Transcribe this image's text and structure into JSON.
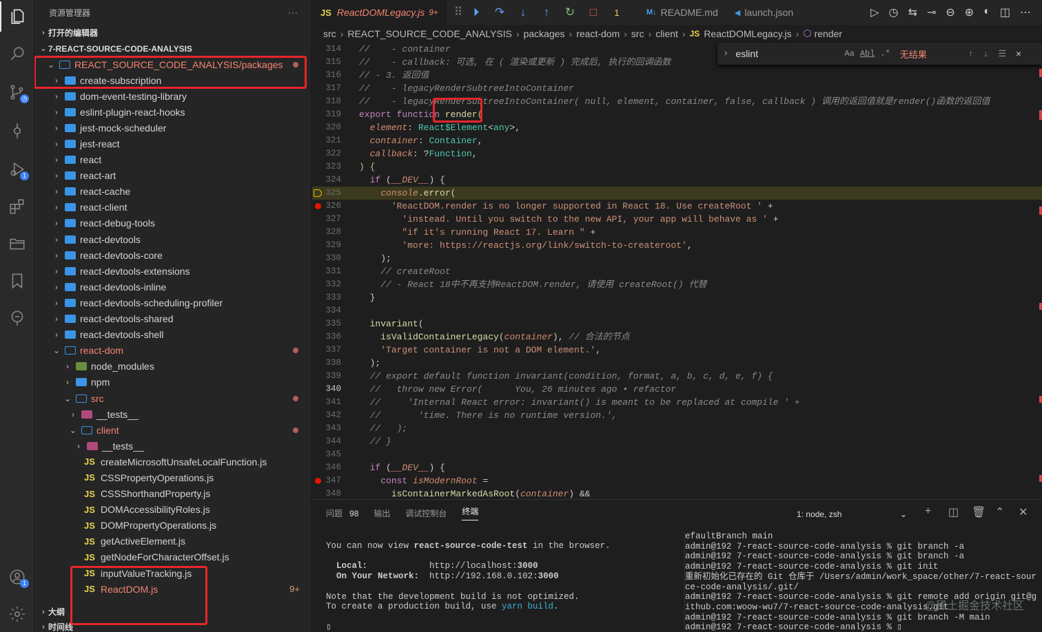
{
  "sidebar": {
    "title": "资源管理器",
    "open_editors": "打开的编辑器",
    "root": "7-REACT-SOURCE-CODE-ANALYSIS",
    "outline": "大纲",
    "timeline": "时间线",
    "items": [
      {
        "label": "REACT_SOURCE_CODE_ANALYSIS/packages",
        "kind": "folder-open",
        "depth": 1,
        "red": true,
        "dot": true
      },
      {
        "label": "create-subscription",
        "kind": "folder",
        "depth": 2
      },
      {
        "label": "dom-event-testing-library",
        "kind": "folder",
        "depth": 2
      },
      {
        "label": "eslint-plugin-react-hooks",
        "kind": "folder",
        "depth": 2
      },
      {
        "label": "jest-mock-scheduler",
        "kind": "folder",
        "depth": 2
      },
      {
        "label": "jest-react",
        "kind": "folder",
        "depth": 2
      },
      {
        "label": "react",
        "kind": "folder",
        "depth": 2
      },
      {
        "label": "react-art",
        "kind": "folder",
        "depth": 2
      },
      {
        "label": "react-cache",
        "kind": "folder",
        "depth": 2
      },
      {
        "label": "react-client",
        "kind": "folder",
        "depth": 2
      },
      {
        "label": "react-debug-tools",
        "kind": "folder",
        "depth": 2
      },
      {
        "label": "react-devtools",
        "kind": "folder",
        "depth": 2
      },
      {
        "label": "react-devtools-core",
        "kind": "folder",
        "depth": 2
      },
      {
        "label": "react-devtools-extensions",
        "kind": "folder",
        "depth": 2
      },
      {
        "label": "react-devtools-inline",
        "kind": "folder",
        "depth": 2
      },
      {
        "label": "react-devtools-scheduling-profiler",
        "kind": "folder",
        "depth": 2
      },
      {
        "label": "react-devtools-shared",
        "kind": "folder",
        "depth": 2
      },
      {
        "label": "react-devtools-shell",
        "kind": "folder",
        "depth": 2
      },
      {
        "label": "react-dom",
        "kind": "folder-open",
        "depth": 2,
        "red": true,
        "dot": true
      },
      {
        "label": "node_modules",
        "kind": "nm",
        "depth": 3
      },
      {
        "label": "npm",
        "kind": "folder",
        "depth": 3
      },
      {
        "label": "src",
        "kind": "folder-open",
        "depth": 3,
        "red": true,
        "dot": true
      },
      {
        "label": "__tests__",
        "kind": "test",
        "depth": 4
      },
      {
        "label": "client",
        "kind": "folder-open",
        "depth": 4,
        "red": true,
        "dot": true
      },
      {
        "label": "__tests__",
        "kind": "test",
        "depth": 5
      },
      {
        "label": "createMicrosoftUnsafeLocalFunction.js",
        "kind": "js",
        "depth": 5
      },
      {
        "label": "CSSPropertyOperations.js",
        "kind": "js",
        "depth": 5
      },
      {
        "label": "CSSShorthandProperty.js",
        "kind": "js",
        "depth": 5
      },
      {
        "label": "DOMAccessibilityRoles.js",
        "kind": "js",
        "depth": 5
      },
      {
        "label": "DOMPropertyOperations.js",
        "kind": "js",
        "depth": 5
      },
      {
        "label": "getActiveElement.js",
        "kind": "js",
        "depth": 5
      },
      {
        "label": "getNodeForCharacterOffset.js",
        "kind": "js",
        "depth": 5
      },
      {
        "label": "inputValueTracking.js",
        "kind": "js",
        "depth": 5
      },
      {
        "label": "ReactDOM.js",
        "kind": "js",
        "depth": 5,
        "red": true,
        "count": "9+"
      }
    ]
  },
  "tabs": [
    {
      "label": "ReactDOMLegacy.js",
      "badge": "9+",
      "icon": "JS"
    },
    {
      "label": "README.md",
      "icon": "M↓"
    },
    {
      "label": "launch.json",
      "icon": "VS"
    }
  ],
  "debug_count": "1",
  "breadcrumb": [
    "src",
    "REACT_SOURCE_CODE_ANALYSIS",
    "packages",
    "react-dom",
    "src",
    "client",
    "ReactDOMLegacy.js",
    "render"
  ],
  "find": {
    "value": "eslint",
    "result": "无结果",
    "opt_case": "Aa",
    "opt_word": "Abl",
    "opt_regex": ".*"
  },
  "code_lines": [
    {
      "n": "314",
      "html": "<span class=\"cm\">//    - container</span>"
    },
    {
      "n": "315",
      "html": "<span class=\"cm\">//    - callback: 可选, 在 ( 渲染或更新 ) 完成后, 执行的回调函数</span>"
    },
    {
      "n": "316",
      "html": "<span class=\"cm\">// - 3. 返回值</span>"
    },
    {
      "n": "317",
      "html": "<span class=\"cm\">//    - legacyRenderSubtreeIntoContainer</span>"
    },
    {
      "n": "318",
      "html": "<span class=\"cm\">//    - legacyRenderSubtreeIntoContainer( null, element, container, false, callback ) 调用的返回值就是render()函数的返回值</span>"
    },
    {
      "n": "319",
      "html": "<span class=\"kw\">export</span> <span class=\"kw\">function</span> <span class=\"fn\">render</span><span class=\"br\">(</span>"
    },
    {
      "n": "320",
      "html": "  <span class=\"var\">element</span>: <span class=\"ty\">React$Element</span>&lt;<span class=\"ty\">any</span>&gt;,"
    },
    {
      "n": "321",
      "html": "  <span class=\"var\">container</span>: <span class=\"ty\">Container</span>,"
    },
    {
      "n": "322",
      "html": "  <span class=\"var\">callback</span>: ?<span class=\"ty\">Function</span>,"
    },
    {
      "n": "323",
      "html": "<span class=\"br\">)</span> <span class=\"br\">{</span>"
    },
    {
      "n": "324",
      "html": "  <span class=\"kw\">if</span> (<span class=\"var\">__DEV__</span>) {"
    },
    {
      "n": "325",
      "html": "    <span class=\"var\">console</span>.<span class=\"fn\">error</span>(",
      "curl": true,
      "bpl": true
    },
    {
      "n": "326",
      "html": "      <span class=\"str\">'ReactDOM.render is no longer supported in React 18. Use createRoot '</span> +",
      "bp": true
    },
    {
      "n": "327",
      "html": "        <span class=\"str\">'instead. Until you switch to the new API, your app will behave as '</span> +"
    },
    {
      "n": "328",
      "html": "        <span class=\"str\">\"if it's running React 17. Learn \"</span> +"
    },
    {
      "n": "329",
      "html": "        <span class=\"str\">'more: https://reactjs.org/link/switch-to-createroot'</span>,"
    },
    {
      "n": "330",
      "html": "    );"
    },
    {
      "n": "331",
      "html": "    <span class=\"cm\">// createRoot</span>"
    },
    {
      "n": "332",
      "html": "    <span class=\"cm\">// - React 18中不再支持ReactDOM.render, 请使用 createRoot() 代替</span>"
    },
    {
      "n": "333",
      "html": "  }"
    },
    {
      "n": "334",
      "html": ""
    },
    {
      "n": "335",
      "html": "  <span class=\"fn\">invariant</span>("
    },
    {
      "n": "336",
      "html": "    <span class=\"fn\">isValidContainerLegacy</span>(<span class=\"var\">container</span>), <span class=\"cm\">// 合法的节点</span>"
    },
    {
      "n": "337",
      "html": "    <span class=\"str\">'Target container is not a DOM element.'</span>,"
    },
    {
      "n": "338",
      "html": "  );"
    },
    {
      "n": "339",
      "html": "  <span class=\"cm\">// export default function invariant(condition, format, a, b, c, d, e, f) {</span>"
    },
    {
      "n": "340",
      "html": "  <span class=\"cm\">//   throw new Error(      You, 26 minutes ago • refactor</span>",
      "cur": true
    },
    {
      "n": "341",
      "html": "  <span class=\"cm\">//     'Internal React error: invariant() is meant to be replaced at compile ' +</span>"
    },
    {
      "n": "342",
      "html": "  <span class=\"cm\">//       'time. There is no runtime version.',</span>"
    },
    {
      "n": "343",
      "html": "  <span class=\"cm\">//   );</span>"
    },
    {
      "n": "344",
      "html": "  <span class=\"cm\">// }</span>"
    },
    {
      "n": "345",
      "html": ""
    },
    {
      "n": "346",
      "html": "  <span class=\"kw\">if</span> (<span class=\"var\">__DEV__</span>) {"
    },
    {
      "n": "347",
      "html": "    <span class=\"kw\">const</span> <span class=\"var\">isModernRoot</span> =",
      "bp": true
    },
    {
      "n": "348",
      "html": "      <span class=\"fn\">isContainerMarkedAsRoot</span>(<span class=\"var\">container</span>) &amp;&amp;"
    }
  ],
  "panel": {
    "tabs": [
      "问题",
      "输出",
      "调试控制台",
      "终端"
    ],
    "problems_count": "98",
    "terminal_select": "1: node, zsh",
    "term_left": [
      "You can now view <b>react-source-code-test</b> in the browser.",
      "",
      "  <b>Local:</b>            http://localhost:<b>3000</b>",
      "  <b>On Your Network:</b>  http://192.168.0.102:<b>3000</b>",
      "",
      "Note that the development build is not optimized.",
      "To create a production build, use <span class=\"cy\">yarn build</span>.",
      "",
      "▯"
    ],
    "term_right": [
      "efaultBranch main",
      "admin@192 7-react-source-code-analysis % git branch -a",
      "admin@192 7-react-source-code-analysis % git branch -a",
      "admin@192 7-react-source-code-analysis % git init",
      "重新初始化已存在的 Git 仓库于 /Users/admin/work_space/other/7-react-source-code-analysis/.git/",
      "admin@192 7-react-source-code-analysis % git remote add origin git@github.com:woow-wu7/7-react-source-code-analysis.git",
      "admin@192 7-react-source-code-analysis % git branch -M main",
      "admin@192 7-react-source-code-analysis % ▯"
    ]
  },
  "watermark": "@稀土掘金技术社区"
}
